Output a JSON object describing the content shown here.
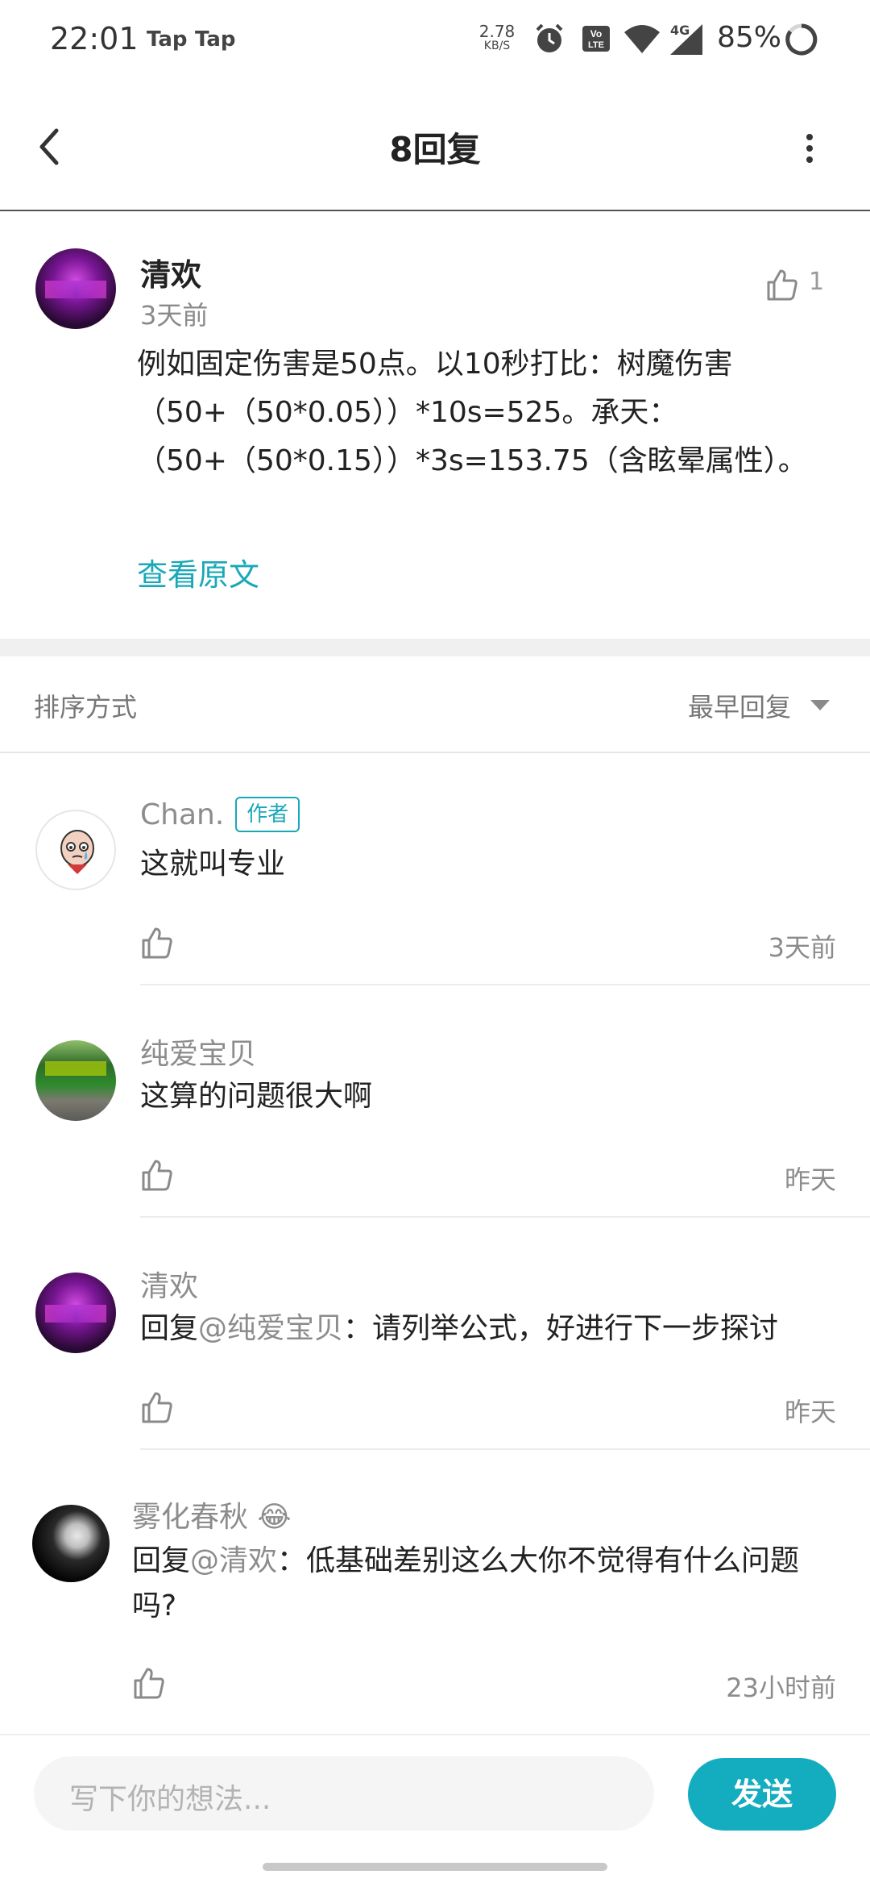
{
  "status_bar": {
    "time": "22:01",
    "app_badges": [
      "Tap",
      "Tap"
    ],
    "net_speed_value": "2.78",
    "net_speed_unit": "KB/S",
    "volte": "VoLTE",
    "network": "4G",
    "battery_percent": "85%",
    "icons": [
      "alarm-icon",
      "volte-icon",
      "wifi-icon",
      "signal-icon",
      "battery-ring-icon"
    ]
  },
  "header": {
    "title": "8回复",
    "back_icon": "chevron-left-icon",
    "more_icon": "more-vertical-icon"
  },
  "post": {
    "author": "清欢",
    "time": "3天前",
    "likes": "1",
    "body": "例如固定伤害是50点。以10秒打比：树魔伤害（50+（50*0.05））*10s=525。承天：（50+（50*0.15））*3s=153.75（含眩晕属性）。",
    "view_original": "查看原文"
  },
  "sort": {
    "label": "排序方式",
    "value": "最早回复"
  },
  "comments": [
    {
      "name": "Chan.",
      "badge": "作者",
      "text": "这就叫专业",
      "time": "3天前"
    },
    {
      "name": "纯爱宝贝",
      "text": "这算的问题很大啊",
      "time": "昨天"
    },
    {
      "name": "清欢",
      "reply_prefix": "回复",
      "mention": "@纯爱宝贝",
      "text": "：请列举公式，好进行下一步探讨",
      "time": "昨天"
    },
    {
      "name": "雾化春秋",
      "name_emoji": "😂",
      "reply_prefix": "回复",
      "mention": "@清欢",
      "text": "：低基础差别这么大你不觉得有什么问题吗?",
      "time": "23小时前"
    }
  ],
  "input_bar": {
    "placeholder": "写下你的想法...",
    "send_label": "发送"
  },
  "colors": {
    "accent": "#14adc0",
    "muted_text": "#8c8c8c"
  }
}
